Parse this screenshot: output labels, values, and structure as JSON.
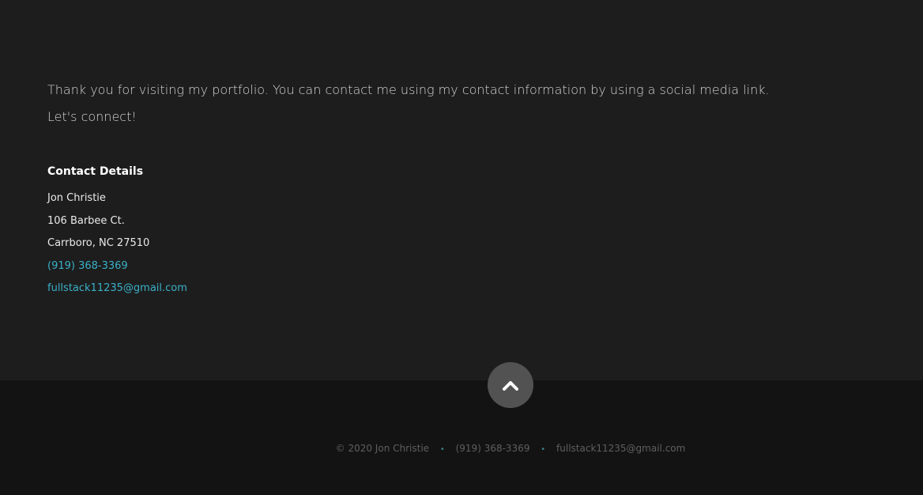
{
  "contact": {
    "intro": "Thank you for visiting my portfolio. You can contact me using my contact information by using a social media link. Let's connect!",
    "heading": "Contact Details",
    "name": "Jon Christie",
    "street": "106 Barbee Ct.",
    "city": "Carrboro, NC 27510",
    "phone": "(919) 368-3369",
    "email": "fullstack11235@gmail.com"
  },
  "footer": {
    "copyright": "© 2020 Jon Christie",
    "phone": "(919) 368-3369",
    "email": "fullstack11235@gmail.com",
    "separator": "•"
  },
  "icons": {
    "back_to_top": "chevron-up-icon"
  },
  "colors": {
    "accent": "#3ab0c8",
    "background": "#1d1d1d",
    "footer_background": "#131313",
    "button": "#525252"
  }
}
